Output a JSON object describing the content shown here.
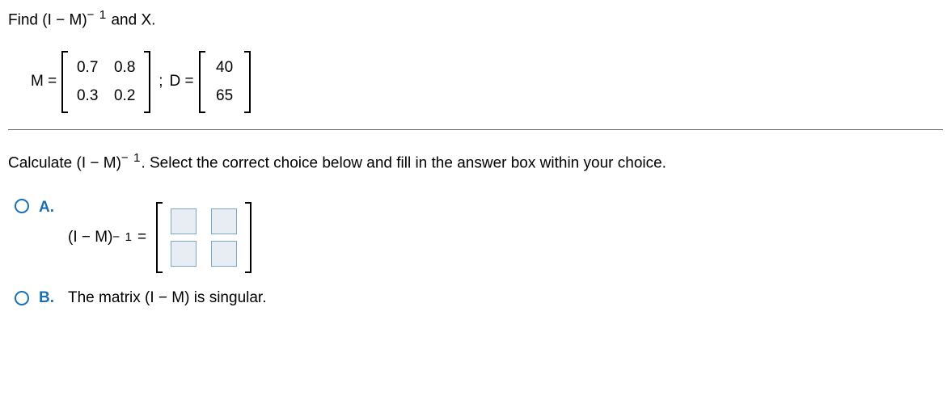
{
  "intro": {
    "left": "Find (I − M)",
    "sup": "− 1",
    "right": " and X."
  },
  "given": {
    "m_label": "M =",
    "m_cells": [
      "0.7",
      "0.8",
      "0.3",
      "0.2"
    ],
    "semi": ";",
    "d_label": "D =",
    "d_cells": [
      "40",
      "65"
    ]
  },
  "instruction": {
    "left": "Calculate (I − M)",
    "sup": "− 1",
    "right": ". Select the correct choice below and fill in the answer box within your choice."
  },
  "choices": {
    "a": {
      "label": "A.",
      "expr_left": "(I − M)",
      "sup": "− 1",
      "eq": "="
    },
    "b": {
      "label": "B.",
      "text": "The matrix (I − M) is singular."
    }
  }
}
